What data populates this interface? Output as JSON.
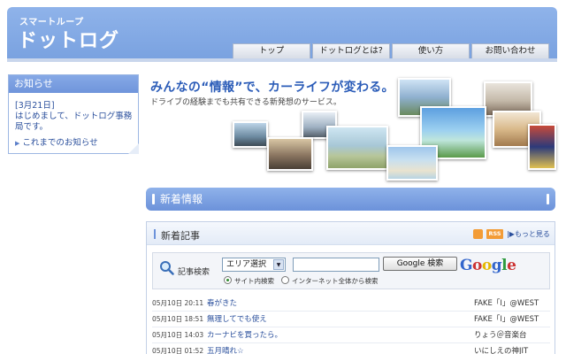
{
  "header": {
    "logo_sub": "スマートループ",
    "logo_main": "ドットログ",
    "nav": [
      "トップ",
      "ドットログとは?",
      "使い方",
      "お問い合わせ"
    ]
  },
  "notice": {
    "title": "お知らせ",
    "date": "[3月21日]",
    "text": "はじめまして、ドットログ事務局です。",
    "more": "これまでのお知らせ"
  },
  "hero": {
    "title": "みんなの“情報”で、カーライフが変わる。",
    "subtitle": "ドライブの経験までも共有できる新発想のサービス。"
  },
  "info_bar": {
    "title": "新着情報"
  },
  "articles": {
    "title": "新着記事",
    "rss": "RSS",
    "more": "もっと見る",
    "search": {
      "label": "記事検索",
      "area_select": "エリア選択",
      "input_value": "",
      "button": "Google 検索",
      "radio_site": "サイト内検索",
      "radio_web": "インターネット全体から検索",
      "selected": "site"
    },
    "rows": [
      {
        "date": "05月10日 20:11",
        "title": "春がきた",
        "author": "FAKE「I」@WEST"
      },
      {
        "date": "05月10日 18:51",
        "title": "無理してでも使え",
        "author": "FAKE「I」@WEST"
      },
      {
        "date": "05月10日 14:03",
        "title": "カーナビを買ったら。",
        "author": "りょう＠音楽台"
      },
      {
        "date": "05月10日 01:52",
        "title": "五月晴れ☆",
        "author": "いにしえの神JIT"
      }
    ]
  },
  "colors": {
    "brand": "#7aa2e0",
    "link": "#2a4f9c",
    "rss": "#f39c36"
  }
}
